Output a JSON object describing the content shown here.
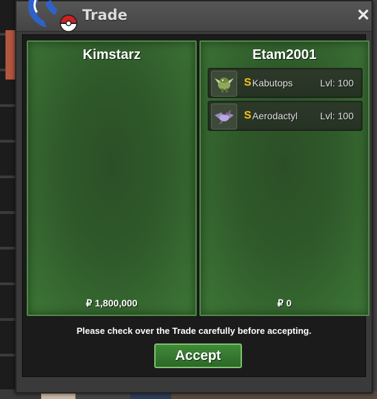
{
  "window": {
    "title": "Trade",
    "close_label": "✕"
  },
  "left_trader": {
    "name": "Kimstarz",
    "currency_symbol": "₽",
    "money": "1,800,000",
    "items": []
  },
  "right_trader": {
    "name": "Etam2001",
    "currency_symbol": "₽",
    "money": "0",
    "items": [
      {
        "shiny_badge": "S",
        "name": "Kabutops",
        "level": "Lvl: 100",
        "icon": "kabutops-icon"
      },
      {
        "shiny_badge": "S",
        "name": "Aerodactyl",
        "level": "Lvl: 100",
        "icon": "aerodactyl-icon"
      }
    ]
  },
  "footer": {
    "notice": "Please check over the Trade carefully before accepting.",
    "accept_label": "Accept"
  },
  "colors": {
    "panel_green": "#2f5a2a",
    "accent_green": "#3f8a37",
    "shiny_gold": "#f0c020"
  }
}
